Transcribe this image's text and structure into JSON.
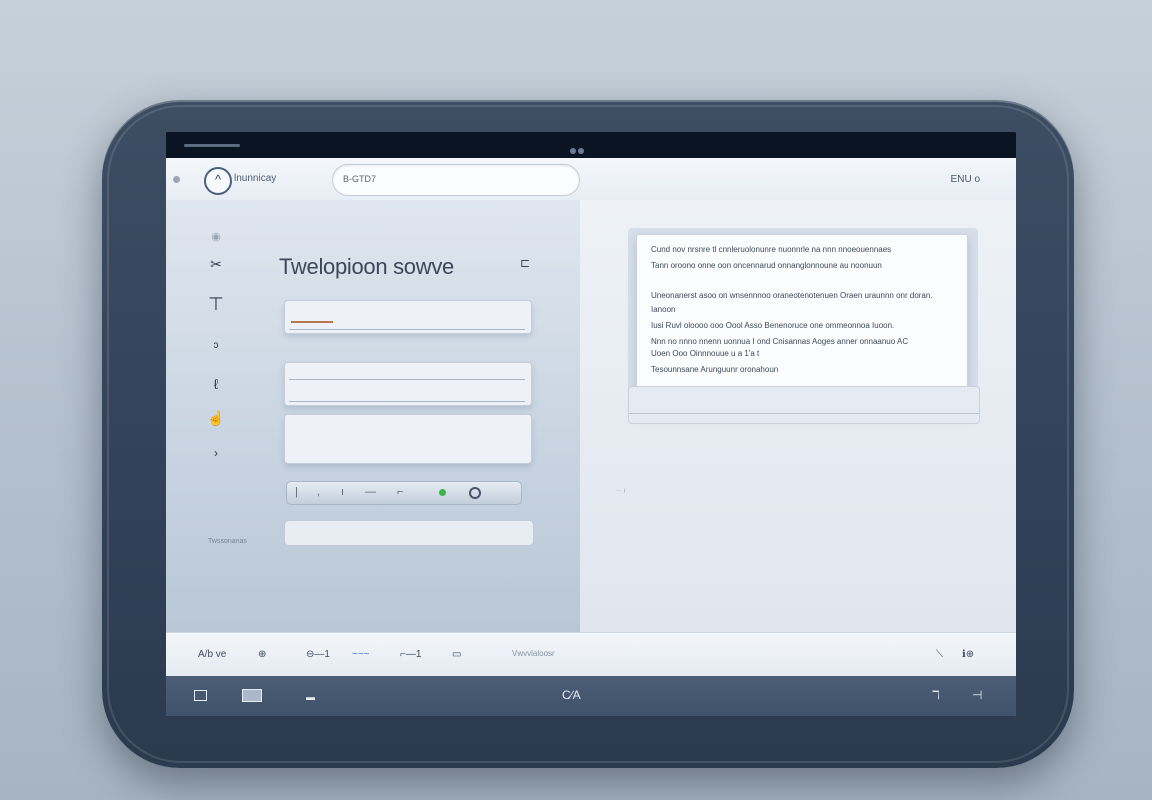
{
  "topbar": {
    "brand": "lnunnicay",
    "search_value": "B-GTD7",
    "right_label": "ENU o"
  },
  "main": {
    "title": "Twelopioon sowve",
    "small_label": "Twssonanas"
  },
  "sidebar": {
    "icons": [
      "user-icon",
      "tools-icon",
      "text-icon",
      "search-icon",
      "list-icon",
      "hand-icon",
      "arrow-icon"
    ]
  },
  "document": {
    "lines": [
      "Cund nov nrsnre tl cnnleruolonunre nuonnrle na nnn nnoeouennaes",
      "Tann oroono onne oon oncennarud onnanglonnoune au noonuun",
      "Uneonanerst asoo on wnsennnoo oraneotenotenuen Oraen uraunnn onr doran.",
      "Ianoon",
      "Iusi Ruvl oloooo ooo Oool Asso Benenoruce one ommeonnoa Iuoon.",
      "Nnn no nnno nnenn uonnua I ond Cnisannas Aoges anner onnaanuo AC",
      "Uoen Ooo Oinnnouue u a 1'a t",
      "Tesounnsane Arunguunr oronahoun"
    ]
  },
  "statusbar": {
    "items": [
      "A/b ve",
      "⊕",
      "⊖—1",
      "~~~",
      "⌐—1",
      "▭",
      "Vwvvlaloosr"
    ],
    "right": [
      "⟍",
      "ℹ⊕"
    ]
  },
  "dock": {
    "center_label": "C∕A",
    "right_items": [
      "ℸ",
      "⊣"
    ]
  }
}
